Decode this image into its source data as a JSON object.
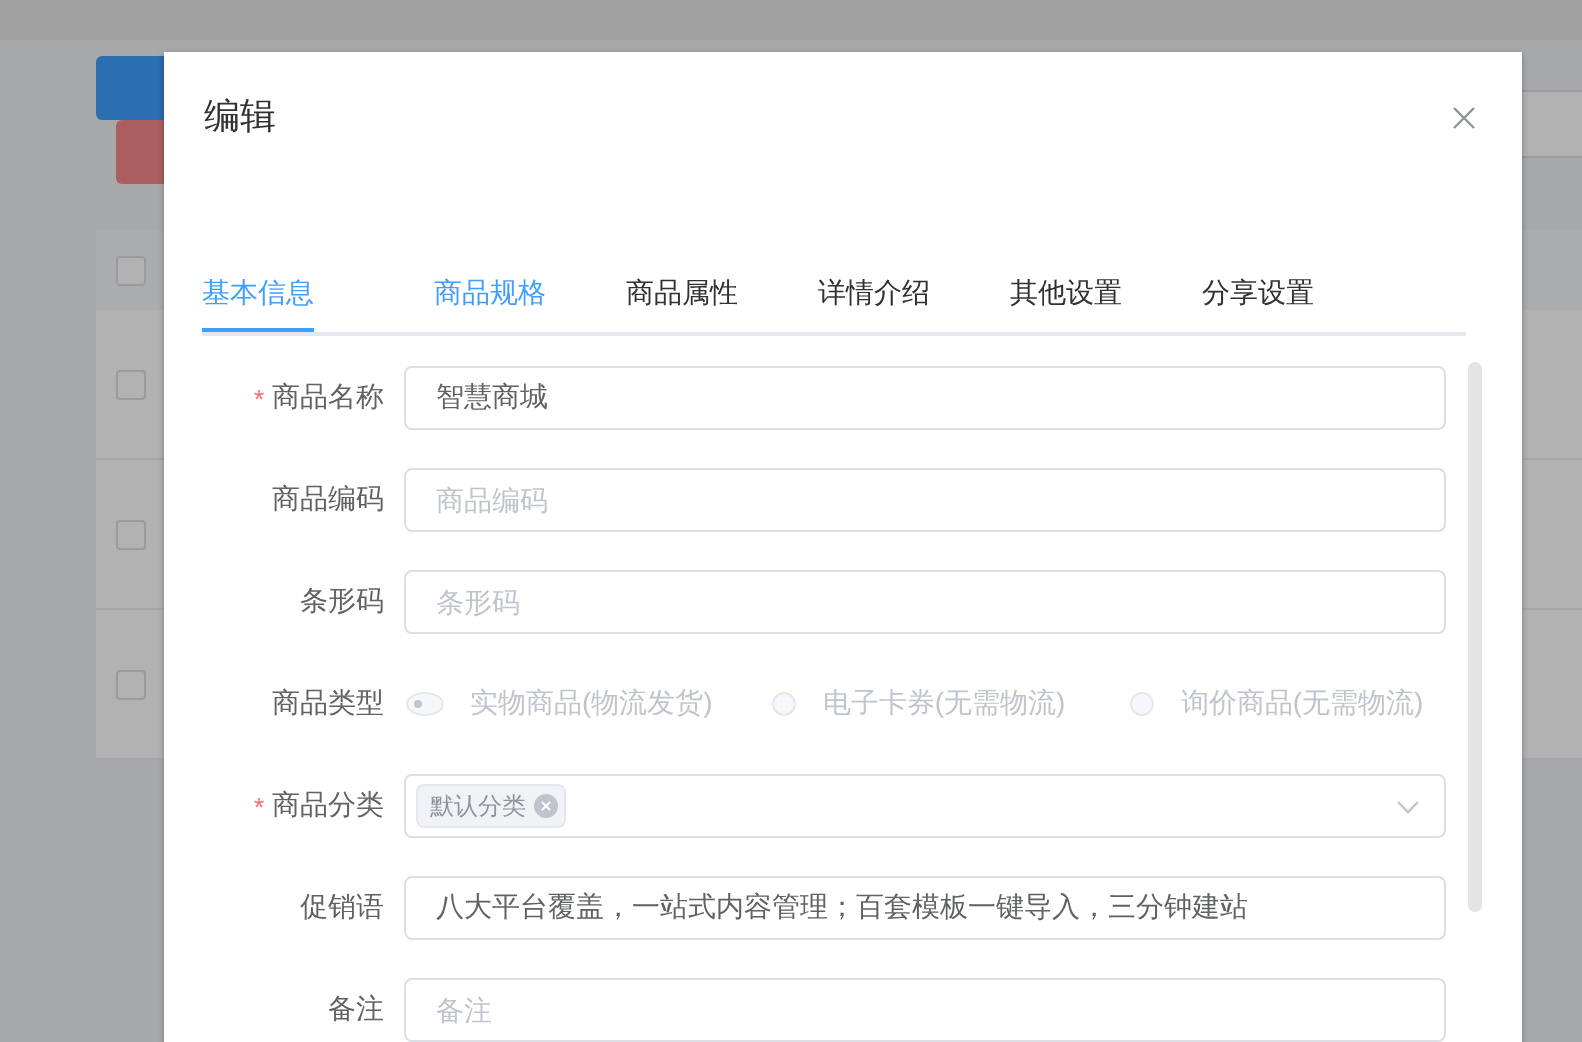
{
  "table": {
    "header_checked": false,
    "rows": [
      {
        "checked": false
      },
      {
        "checked": false
      },
      {
        "checked": false
      }
    ]
  },
  "dialog": {
    "title": "编辑",
    "tabs": [
      {
        "label": "基本信息",
        "selected": true,
        "hovered": false
      },
      {
        "label": "商品规格",
        "selected": false,
        "hovered": true
      },
      {
        "label": "商品属性",
        "selected": false,
        "hovered": false
      },
      {
        "label": "详情介绍",
        "selected": false,
        "hovered": false
      },
      {
        "label": "其他设置",
        "selected": false,
        "hovered": false
      },
      {
        "label": "分享设置",
        "selected": false,
        "hovered": false
      }
    ],
    "required_mark": "*",
    "form": [
      {
        "kind": "input",
        "label": "商品名称",
        "required": true,
        "value": "智慧商城"
      },
      {
        "kind": "input",
        "label": "商品编码",
        "required": false,
        "placeholder": "商品编码"
      },
      {
        "kind": "input",
        "label": "条形码",
        "required": false,
        "placeholder": "条形码"
      },
      {
        "kind": "radio",
        "label": "商品类型",
        "required": false,
        "options": [
          {
            "label": "实物商品(物流发货)",
            "selected": true,
            "disabled": true
          },
          {
            "label": "电子卡券(无需物流)",
            "selected": false,
            "disabled": true
          },
          {
            "label": "询价商品(无需物流)",
            "selected": false,
            "disabled": true
          }
        ]
      },
      {
        "kind": "select",
        "label": "商品分类",
        "required": true,
        "tags": [
          "默认分类"
        ]
      },
      {
        "kind": "input",
        "label": "促销语",
        "required": false,
        "value": "八大平台覆盖，一站式内容管理；百套模板一键导入，三分钟建站"
      },
      {
        "kind": "input",
        "label": "备注",
        "required": false,
        "placeholder": "备注"
      }
    ]
  }
}
